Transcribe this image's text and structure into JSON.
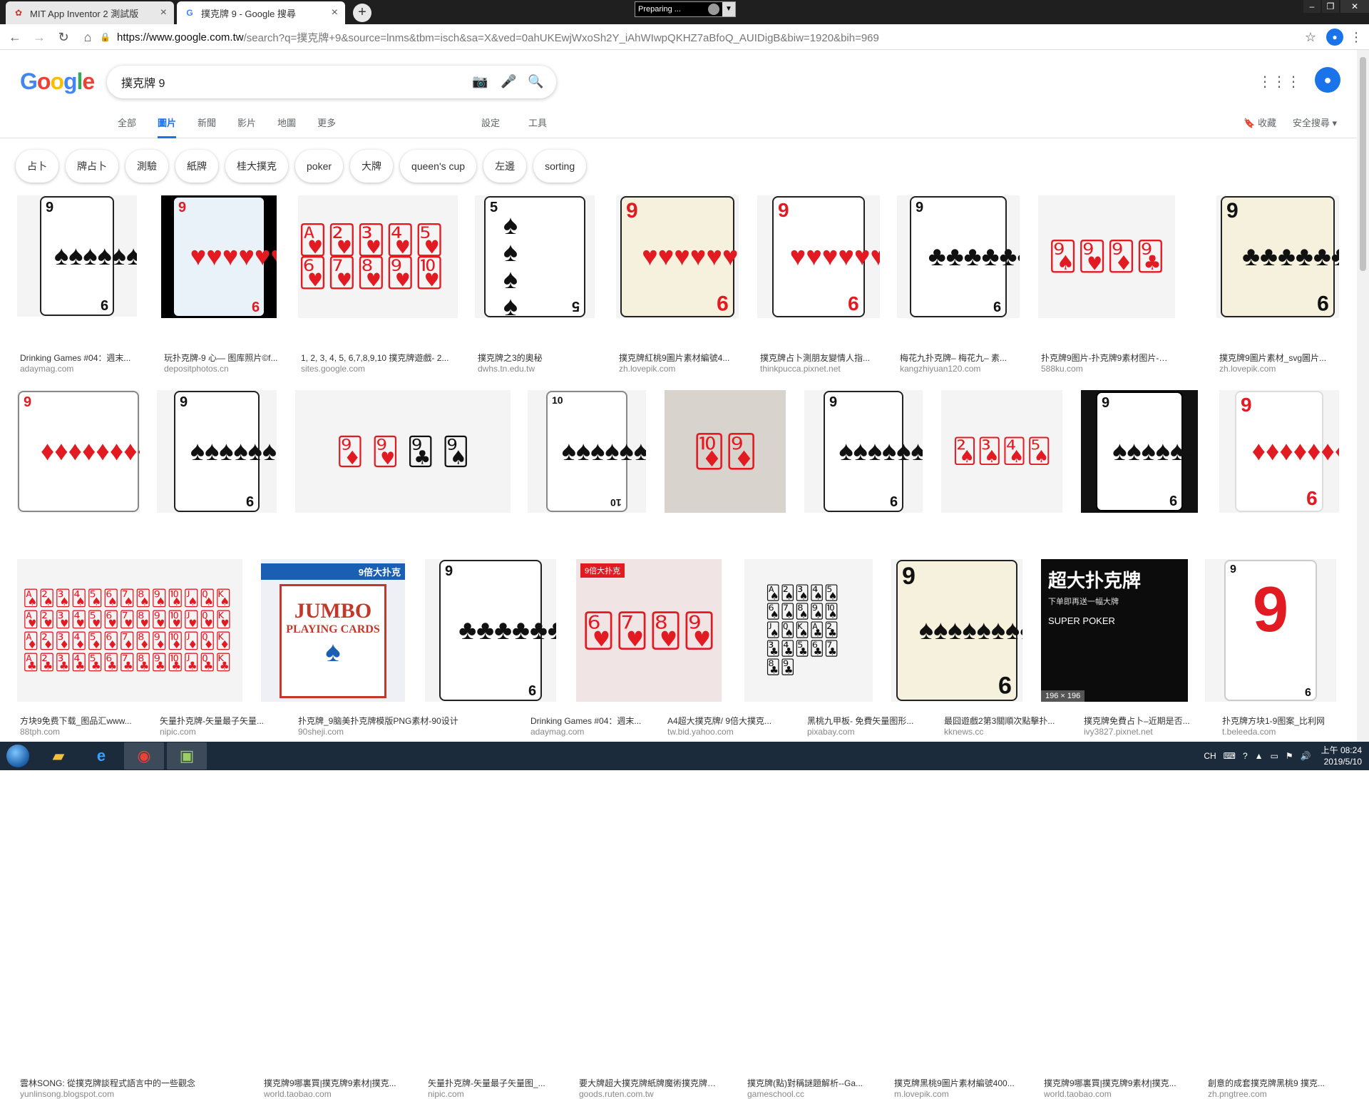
{
  "browser": {
    "tabs": [
      {
        "title": "MIT App Inventor 2 測試版",
        "active": false
      },
      {
        "title": "撲克牌 9 - Google 搜尋",
        "active": true
      }
    ],
    "preparing_label": "Preparing ...",
    "url_domain": "https://www.google.com.tw",
    "url_path": "/search?q=撲克牌+9&source=lnms&tbm=isch&sa=X&ved=0ahUKEwjWxoSh2Y_iAhWIwpQKHZ7aBfoQ_AUIDigB&biw=1920&bih=969"
  },
  "google": {
    "logo": "Google",
    "query": "撲克牌 9",
    "nav_tabs": [
      "全部",
      "圖片",
      "新聞",
      "影片",
      "地圖",
      "更多"
    ],
    "active_tab": "圖片",
    "settings": "設定",
    "tools": "工具",
    "collections": "收藏",
    "safe_search": "安全搜尋"
  },
  "chips": [
    "占卜",
    "牌占卜",
    "測驗",
    "紙牌",
    "桂大撲克",
    "poker",
    "大牌",
    "queen's cup",
    "左邊",
    "sorting"
  ],
  "results": [
    {
      "caption": "Drinking Games #04：週末...",
      "source": "adaymag.com"
    },
    {
      "caption": "玩扑克牌-9 心— 图库照片©f...",
      "source": "depositphotos.cn"
    },
    {
      "caption": "1, 2, 3, 4, 5, 6,7,8,9,10 撲克牌遊戲- 2...",
      "source": "sites.google.com"
    },
    {
      "caption": "撲克牌之3的奧秘",
      "source": "dwhs.tn.edu.tw"
    },
    {
      "caption": "撲克牌紅桃9圖片素材編號4...",
      "source": "zh.lovepik.com"
    },
    {
      "caption": "撲克牌占卜測朋友變情人指...",
      "source": "thinkpucca.pixnet.net"
    },
    {
      "caption": "梅花九扑克牌– 梅花九– 素...",
      "source": "kangzhiyuan120.com"
    },
    {
      "caption": "扑克牌9图片-扑克牌9素材图片-扑克牌...",
      "source": "588ku.com"
    },
    {
      "caption": "撲克牌9圖片素材_svg圖片...",
      "source": "zh.lovepik.com"
    },
    {
      "caption": "方块9免费下载_图品汇www...",
      "source": "88tph.com"
    },
    {
      "caption": "矢量扑克牌-矢量最子矢量...",
      "source": "nipic.com"
    },
    {
      "caption": "扑克牌_9脑美扑克牌模版PNG素材-90设计",
      "source": "90sheji.com"
    },
    {
      "caption": "Drinking Games #04：週末...",
      "source": "adaymag.com"
    },
    {
      "caption": "A4超大撲克牌/ 9倍大撲克...",
      "source": "tw.bid.yahoo.com"
    },
    {
      "caption": "黑桃九甲板- 免費矢量图形...",
      "source": "pixabay.com"
    },
    {
      "caption": "最囧遊戲2第3關順次點擊扑...",
      "source": "kknews.cc"
    },
    {
      "caption": "撲克牌免費占卜–近期是否...",
      "source": "ivy3827.pixnet.net"
    },
    {
      "caption": "扑克牌方块1-9图案_比利网",
      "source": "t.beleeda.com"
    },
    {
      "caption": "雲林SONG: 從撲克牌談程式語言中的一些觀念",
      "source": "yunlinsong.blogspot.com"
    },
    {
      "caption": "撲克牌9哪裏買|撲克牌9素材|撲克...",
      "source": "world.taobao.com"
    },
    {
      "caption": "矢量扑克牌-矢量最子矢量图_...",
      "source": "nipic.com"
    },
    {
      "caption": "要大牌超大撲克牌紙牌魔術撲克牌大...",
      "source": "goods.ruten.com.tw"
    },
    {
      "caption": "撲克牌(點)對稱謎題解析--Ga...",
      "source": "gameschool.cc"
    },
    {
      "caption": "撲克牌黑桃9圖片素材編號400...",
      "source": "m.lovepik.com"
    },
    {
      "caption": "撲克牌9哪裏買|撲克牌9素材|撲克...",
      "source": "world.taobao.com"
    },
    {
      "caption": "創意的成套撲克牌黑桃9 撲克...",
      "source": "zh.pngtree.com"
    }
  ],
  "thumb_texts": {
    "rank": "9",
    "rank10": "10",
    "rank5": "5",
    "jumbo": "JUMBO",
    "playing_cards": "PLAYING CARDS",
    "nine_times": "9倍大扑克",
    "big_poker": "超大扑克牌",
    "big_poker_sub": "下单即再送一幅大牌",
    "super_poker": "SUPER POKER",
    "size_badge": "196 × 196"
  },
  "taskbar": {
    "lang": "CH",
    "time": "上午 08:24",
    "date": "2019/5/10"
  }
}
